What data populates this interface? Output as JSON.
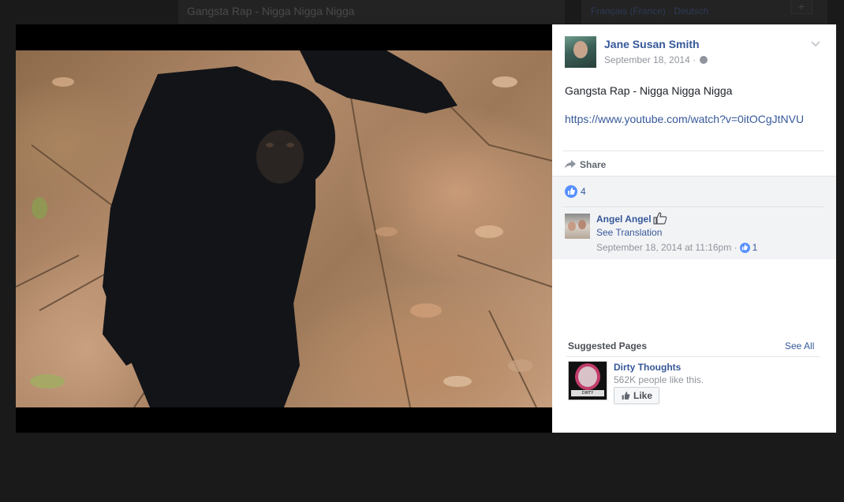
{
  "background": {
    "post_title": "Gangsta Rap - Nigga Nigga Nigga",
    "languages": "Français (France) · Deutsch",
    "plus_label": "+"
  },
  "post": {
    "author_name": "Jane Susan Smith",
    "date": "September 18, 2014 ·",
    "text": "Gangsta Rap - Nigga Nigga Nigga",
    "link": "https://www.youtube.com/watch?v=0itOCgJtNVU",
    "share_label": "Share",
    "like_count": "4"
  },
  "comment": {
    "author": "Angel Angel",
    "see_translation": "See Translation",
    "timestamp": "September 18, 2014 at 11:16pm ·",
    "like_count": "1"
  },
  "suggested": {
    "title": "Suggested Pages",
    "see_all": "See All",
    "page_name": "Dirty Thoughts",
    "page_likes": "562K people like this.",
    "like_button": "Like",
    "thumb_caption": "DIRTY THOUGHTS"
  },
  "colors": {
    "link_blue": "#365899",
    "like_blue": "#5890ff",
    "overlay_bg": "#1b1b1b"
  },
  "icons": [
    "globe-icon",
    "chevron-down-icon",
    "share-arrow-icon",
    "like-thumb-icon",
    "thumb-outline-icon"
  ]
}
